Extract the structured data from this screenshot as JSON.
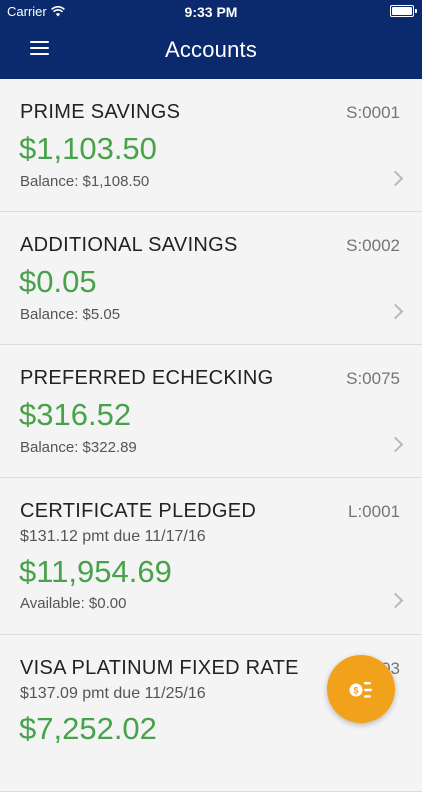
{
  "status_bar": {
    "carrier": "Carrier",
    "time": "9:33 PM"
  },
  "header": {
    "title": "Accounts"
  },
  "accounts": [
    {
      "name": "PRIME SAVINGS",
      "number": "S:0001",
      "amount": "$1,103.50",
      "sub": "Balance: $1,108.50"
    },
    {
      "name": "ADDITIONAL SAVINGS",
      "number": "S:0002",
      "amount": "$0.05",
      "sub": "Balance: $5.05"
    },
    {
      "name": "PREFERRED ECHECKING",
      "number": "S:0075",
      "amount": "$316.52",
      "sub": "Balance: $322.89"
    },
    {
      "name": "CERTIFICATE PLEDGED",
      "number": "L:0001",
      "payment": "$131.12 pmt due 11/17/16",
      "amount": "$11,954.69",
      "sub": "Available: $0.00"
    },
    {
      "name": "VISA PLATINUM FIXED RATE",
      "number": "03",
      "payment": "$137.09 pmt due 11/25/16",
      "amount": "$7,252.02"
    }
  ],
  "colors": {
    "header_bg": "#0b2a6e",
    "amount_green": "#48a24a",
    "fab_orange": "#f2a21a"
  },
  "icons": {
    "menu": "hamburger-menu-icon",
    "fab": "transfer-money-icon",
    "row": "chevron-right-icon"
  }
}
